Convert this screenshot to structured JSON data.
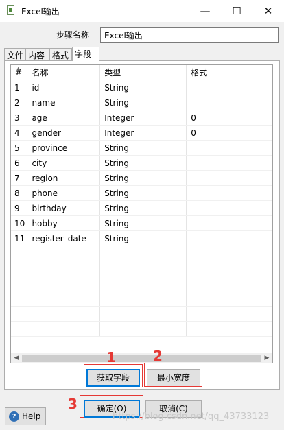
{
  "window": {
    "title": "Excel输出",
    "min_glyph": "—",
    "max_glyph": "☐",
    "close_glyph": "✕"
  },
  "step_name": {
    "label": "步骤名称",
    "value": "Excel输出"
  },
  "tabs": [
    "文件",
    "内容",
    "格式",
    "字段"
  ],
  "active_tab": "字段",
  "table": {
    "columns": [
      "#",
      "名称",
      "类型",
      "格式"
    ],
    "rows": [
      [
        "1",
        "id",
        "String",
        ""
      ],
      [
        "2",
        "name",
        "String",
        ""
      ],
      [
        "3",
        "age",
        "Integer",
        "0"
      ],
      [
        "4",
        "gender",
        "Integer",
        "0"
      ],
      [
        "5",
        "province",
        "String",
        ""
      ],
      [
        "6",
        "city",
        "String",
        ""
      ],
      [
        "7",
        "region",
        "String",
        ""
      ],
      [
        "8",
        "phone",
        "String",
        ""
      ],
      [
        "9",
        "birthday",
        "String",
        ""
      ],
      [
        "10",
        "hobby",
        "String",
        ""
      ],
      [
        "11",
        "register_date",
        "String",
        ""
      ]
    ],
    "empty_rows": 6
  },
  "buttons": {
    "get_fields": "获取字段",
    "min_width": "最小宽度",
    "ok": "确定(O)",
    "cancel": "取消(C)",
    "help": "Help"
  },
  "annotations": [
    "1",
    "2",
    "3"
  ],
  "colors": {
    "annotation_red": "#e53935",
    "default_button_border": "#0078d7"
  },
  "watermark": "https://blog.csdn.net/qq_43733123"
}
